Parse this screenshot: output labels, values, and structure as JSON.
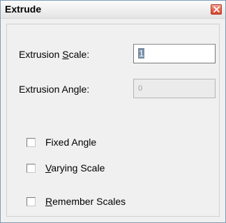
{
  "window": {
    "title": "Extrude",
    "close_icon": "close-icon"
  },
  "fields": {
    "extrusion_scale": {
      "label_prefix": "Extrusion ",
      "label_accel": "S",
      "label_suffix": "cale:",
      "value": "1",
      "enabled": true
    },
    "extrusion_angle": {
      "label": "Extrusion Angle:",
      "value": "0",
      "enabled": false
    }
  },
  "checkboxes": [
    {
      "label_prefix": "",
      "label_accel": "",
      "label_suffix": "Fixed Angle",
      "checked": false
    },
    {
      "label_prefix": "",
      "label_accel": "V",
      "label_suffix": "arying Scale",
      "checked": false
    },
    {
      "label_prefix": "",
      "label_accel": "R",
      "label_suffix": "emember Scales",
      "checked": false
    }
  ]
}
